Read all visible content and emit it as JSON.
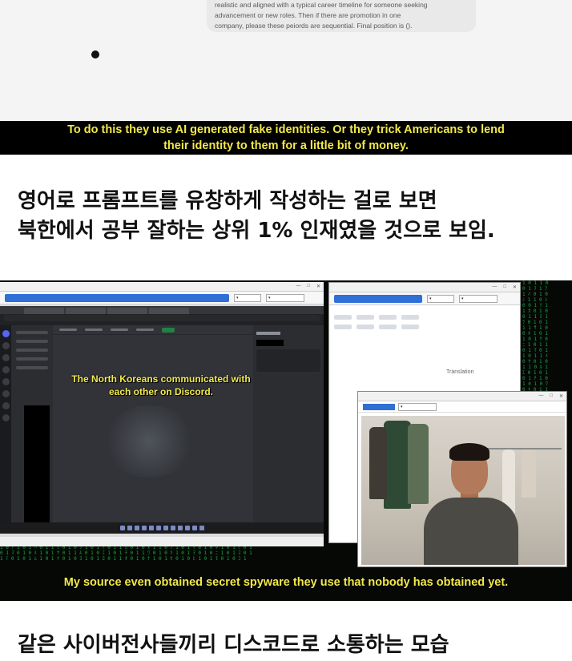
{
  "panel1": {
    "prompt_lines": [
      "realistic and aligned with a typical career timeline for someone seeking",
      "advancement or new roles. Then if there are promotion in one",
      "company, please these peiords are sequential. Final position is ()."
    ],
    "subtitle_lines": [
      "To do this they use AI generated fake identities. Or they trick Americans to lend",
      "their identity to them for a little bit of money."
    ]
  },
  "caption1": {
    "lines": [
      "영어로 프롬프트를 유창하게 작성하는 걸로 보면",
      "북한에서 공부 잘하는 상위 1% 인재였을 것으로 보임."
    ]
  },
  "panel2": {
    "overlay_caption_lines": [
      "The North Koreans communicated with",
      "each other on Discord."
    ],
    "subtitle": "My source even obtained secret spyware they use that nobody has obtained yet.",
    "translator_label": "Translation",
    "colors": {
      "capture_button": "#2f6fd6",
      "discord_bg": "#313338",
      "matrix_green": "#2bd65e",
      "subtitle_yellow": "#f2e94a"
    }
  },
  "caption2": {
    "text": "같은 사이버전사들끼리 디스코드로 소통하는 모습"
  }
}
